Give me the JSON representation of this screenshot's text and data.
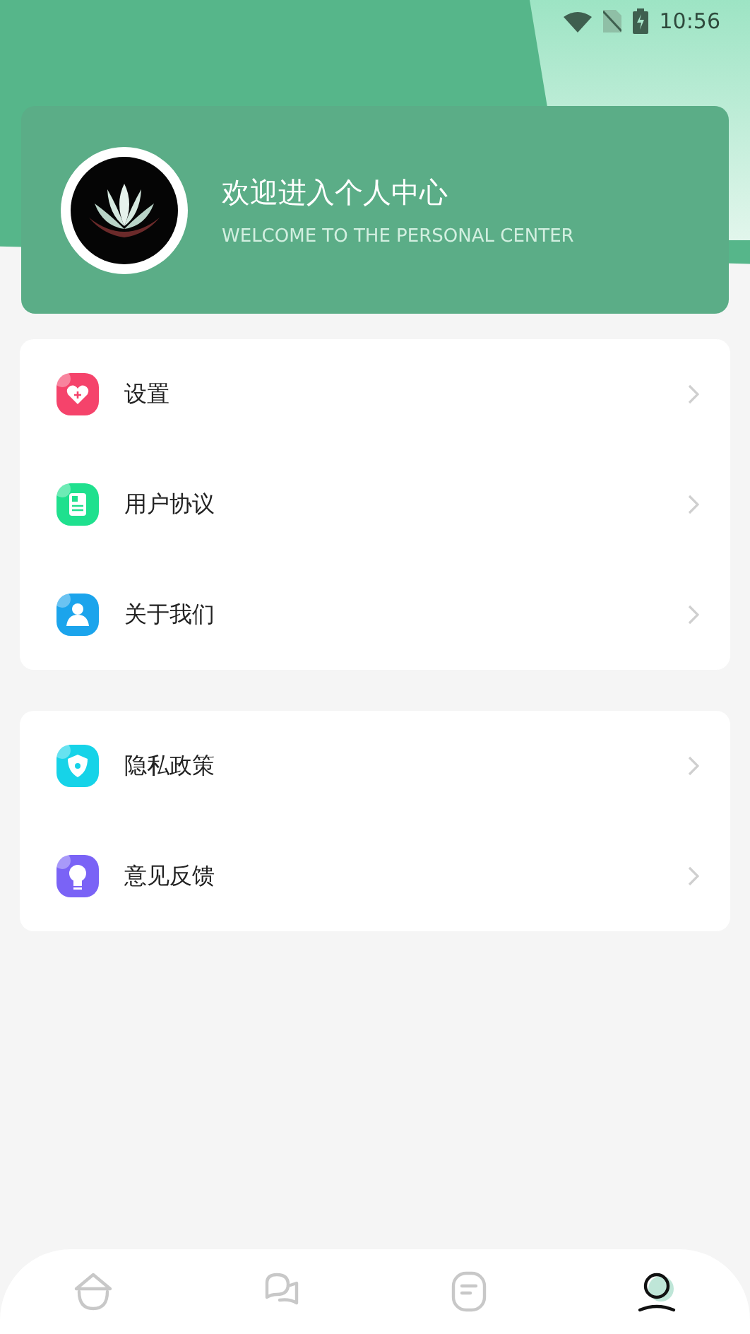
{
  "status_bar": {
    "time": "10:56"
  },
  "profile": {
    "title": "欢迎进入个人中心",
    "subtitle": "WELCOME TO THE PERSONAL CENTER"
  },
  "menu_groups": [
    {
      "items": [
        {
          "label": "设置",
          "kind": "heart",
          "color": "#f5436b"
        },
        {
          "label": "用户协议",
          "kind": "document",
          "color": "#1fe08e"
        },
        {
          "label": "关于我们",
          "kind": "person",
          "color": "#1ba4ec"
        }
      ]
    },
    {
      "items": [
        {
          "label": "隐私政策",
          "kind": "shield",
          "color": "#16d3e8"
        },
        {
          "label": "意见反馈",
          "kind": "bulb",
          "color": "#7a63f6"
        }
      ]
    }
  ],
  "tabs": [
    {
      "kind": "home",
      "selected": false
    },
    {
      "kind": "chat",
      "selected": false
    },
    {
      "kind": "notes",
      "selected": false
    },
    {
      "kind": "profile",
      "selected": true
    }
  ]
}
